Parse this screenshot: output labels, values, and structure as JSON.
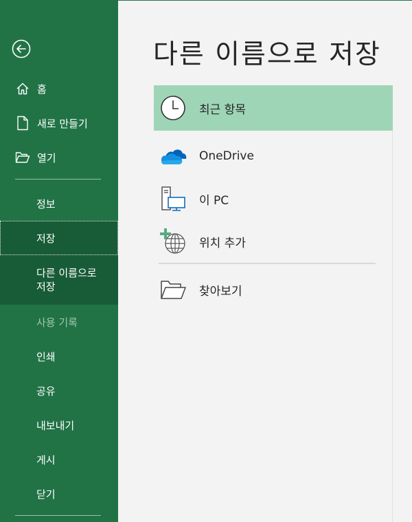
{
  "sidebar": {
    "top_items": [
      {
        "label": "홈",
        "icon": "home-icon"
      },
      {
        "label": "새로 만들기",
        "icon": "new-file-icon"
      },
      {
        "label": "열기",
        "icon": "open-folder-icon"
      }
    ],
    "items": [
      {
        "label": "정보"
      },
      {
        "label": "저장"
      },
      {
        "label": "다른 이름으로 저장",
        "line1": "다른 이름으로",
        "line2": "저장"
      },
      {
        "label": "사용 기록"
      },
      {
        "label": "인쇄"
      },
      {
        "label": "공유"
      },
      {
        "label": "내보내기"
      },
      {
        "label": "게시"
      },
      {
        "label": "닫기"
      }
    ]
  },
  "main": {
    "title": "다른 이름으로 저장",
    "locations": [
      {
        "label": "최근 항목",
        "icon": "clock-icon"
      },
      {
        "label": "OneDrive",
        "icon": "onedrive-cloud-icon"
      },
      {
        "label": "이 PC",
        "icon": "computer-icon"
      },
      {
        "label": "위치 추가",
        "icon": "add-globe-icon"
      },
      {
        "label": "찾아보기",
        "icon": "folder-browse-icon"
      }
    ]
  },
  "colors": {
    "sidebar_bg": "#217346",
    "sidebar_selected": "#185c37",
    "recent_highlight": "#9fd5b7",
    "page_bg": "#f3f3f3"
  }
}
